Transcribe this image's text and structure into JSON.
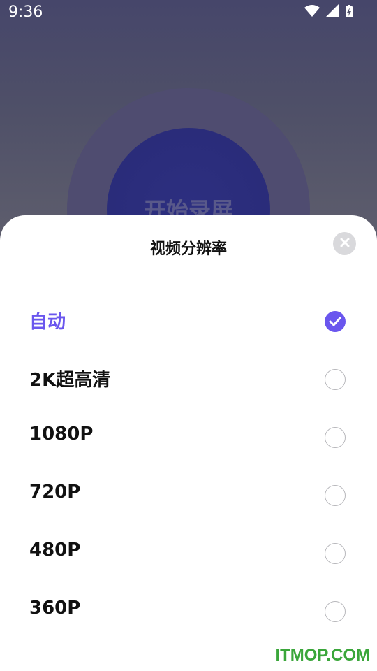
{
  "status_bar": {
    "time": "9:36",
    "icons": [
      "wifi-icon",
      "signal-icon",
      "battery-charging-icon"
    ]
  },
  "record_button": {
    "label": "开始录屏"
  },
  "sheet": {
    "title": "视频分辨率",
    "close_icon": "close-icon",
    "options": [
      {
        "label": "自动",
        "selected": true
      },
      {
        "label": "2K超高清",
        "selected": false
      },
      {
        "label": "1080P",
        "selected": false
      },
      {
        "label": "720P",
        "selected": false
      },
      {
        "label": "480P",
        "selected": false
      },
      {
        "label": "360P",
        "selected": false
      }
    ]
  },
  "watermark": "ITMOP.COM",
  "colors": {
    "accent": "#6a56ee",
    "watermark": "#3aa63a"
  }
}
